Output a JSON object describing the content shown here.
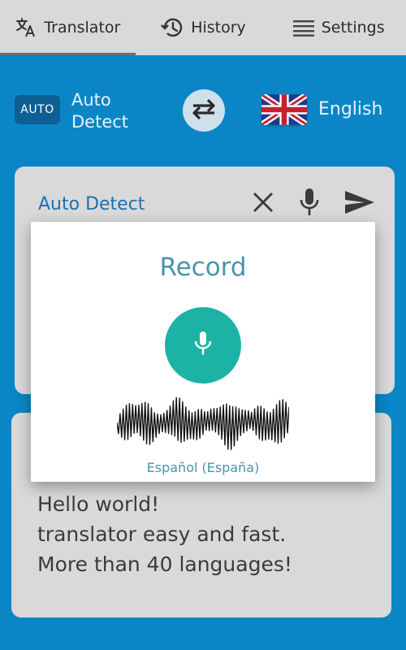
{
  "tabs": [
    {
      "label": "Translator",
      "icon": "translate-icon",
      "active": true
    },
    {
      "label": "History",
      "icon": "history-icon",
      "active": false
    },
    {
      "label": "Settings",
      "icon": "menu-icon",
      "active": false
    }
  ],
  "language_bar": {
    "source_badge": "AUTO",
    "source_label": "Auto\nDetect",
    "swap_icon": "swap-arrows-icon",
    "target_flag": "uk-flag-icon",
    "target_label": "English"
  },
  "input_card": {
    "language": "Auto Detect",
    "clear_icon": "close-icon",
    "mic_icon": "microphone-icon",
    "send_icon": "send-icon"
  },
  "record_dialog": {
    "title": "Record",
    "mic_icon": "microphone-icon",
    "language": "Español (España)"
  },
  "output_card": {
    "lines": [
      "Hello world!",
      "translator easy and fast.",
      "More than 40 languages!"
    ]
  },
  "colors": {
    "background": "#0a86c6",
    "tabbar": "#d9d9d9",
    "card": "#d9d9d9",
    "accent_teal": "#1db3a4",
    "dialog_text": "#4a93ad",
    "language_blue": "#1a73b0"
  }
}
